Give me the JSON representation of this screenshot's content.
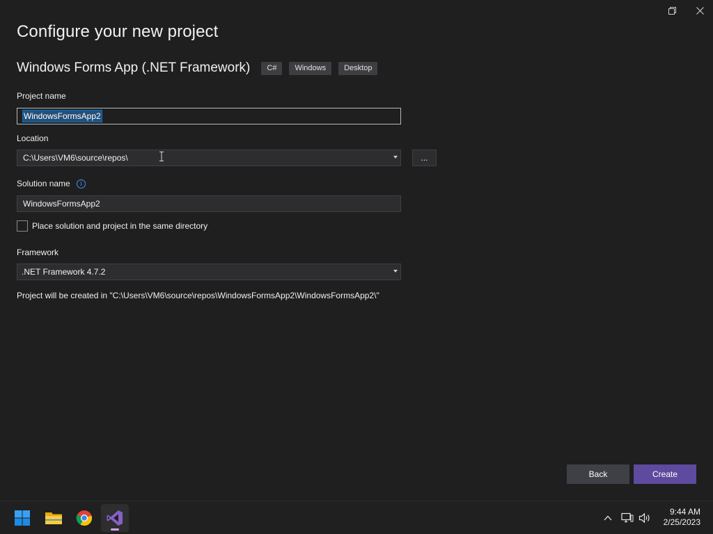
{
  "window": {
    "title": "Configure your new project",
    "template_name": "Windows Forms App (.NET Framework)",
    "tags": [
      "C#",
      "Windows",
      "Desktop"
    ],
    "controls": {
      "restore_icon": "restore-icon",
      "close_icon": "close-icon"
    }
  },
  "form": {
    "project_name": {
      "label": "Project name",
      "value": "WindowsFormsApp2"
    },
    "location": {
      "label": "Location",
      "value": "C:\\Users\\VM6\\source\\repos\\",
      "browse_label": "..."
    },
    "solution_name": {
      "label": "Solution name",
      "value": "WindowsFormsApp2",
      "info_icon": "info-icon"
    },
    "same_directory": {
      "label": "Place solution and project in the same directory",
      "checked": false
    },
    "framework": {
      "label": "Framework",
      "value": ".NET Framework 4.7.2"
    },
    "path_note": "Project will be created in \"C:\\Users\\VM6\\source\\repos\\WindowsFormsApp2\\WindowsFormsApp2\\\""
  },
  "buttons": {
    "back": "Back",
    "create": "Create"
  },
  "colors": {
    "accent": "#5e4a9e",
    "background": "#1f1f1f",
    "input_bg": "#2d2d30",
    "selection": "#264f78"
  },
  "taskbar": {
    "apps": [
      {
        "name": "start",
        "icon": "windows-start-icon"
      },
      {
        "name": "file-explorer",
        "icon": "folder-icon"
      },
      {
        "name": "chrome",
        "icon": "chrome-icon"
      },
      {
        "name": "visual-studio",
        "icon": "visual-studio-icon",
        "active": true
      }
    ],
    "tray": {
      "overflow_icon": "chevron-up-icon",
      "network_icon": "network-icon",
      "volume_icon": "volume-icon"
    },
    "clock": {
      "time": "9:44 AM",
      "date": "2/25/2023"
    }
  }
}
